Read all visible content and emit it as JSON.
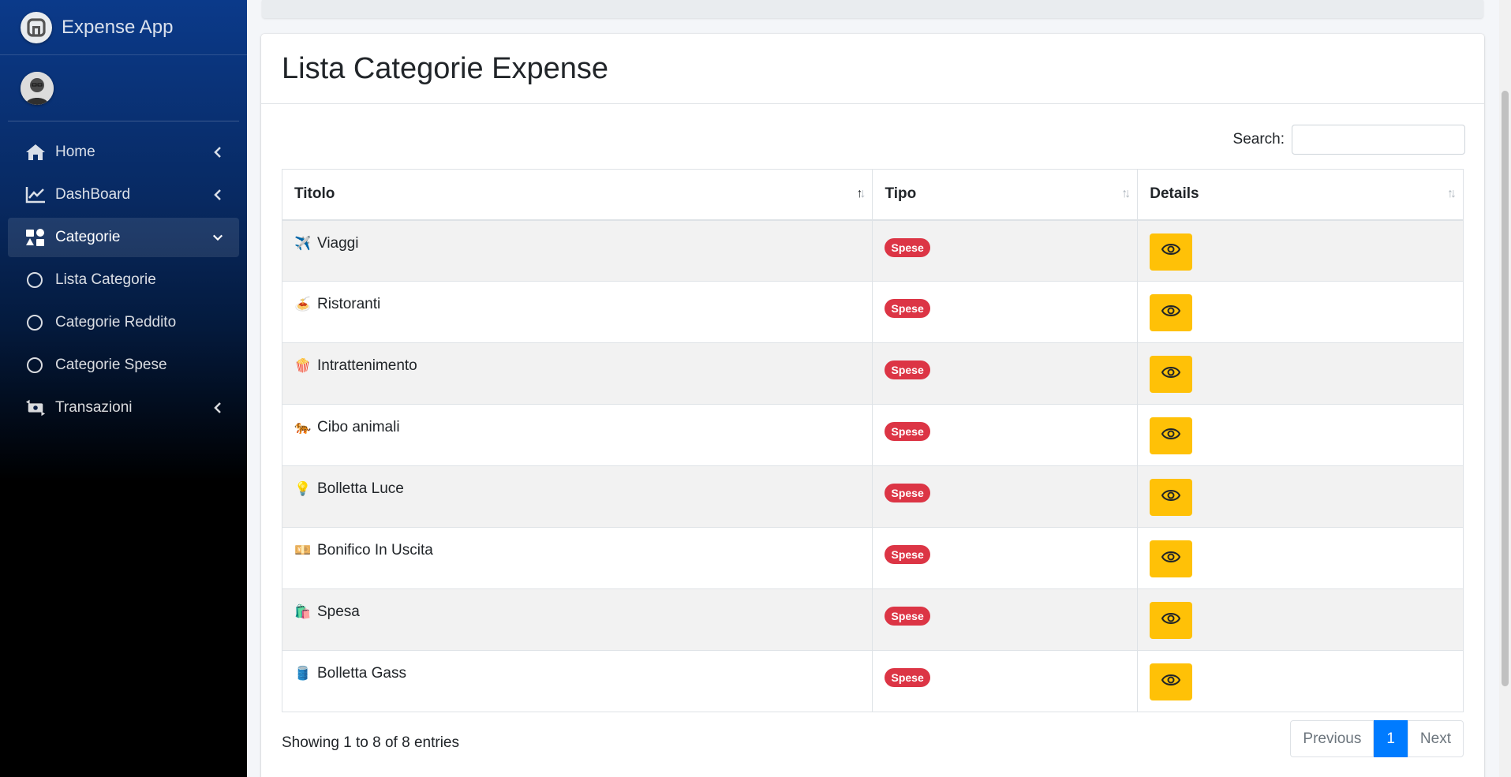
{
  "app": {
    "title": "Expense App"
  },
  "sidebar": {
    "items": [
      {
        "label": "Home",
        "icon": "home-icon"
      },
      {
        "label": "DashBoard",
        "icon": "chart-line-icon"
      },
      {
        "label": "Categorie",
        "icon": "categories-icon"
      },
      {
        "label": "Lista Categorie"
      },
      {
        "label": "Categorie Reddito"
      },
      {
        "label": "Categorie Spese"
      },
      {
        "label": "Transazioni",
        "icon": "money-transfer-icon"
      }
    ]
  },
  "main": {
    "title": "Lista Categorie Expense",
    "search": {
      "label": "Search:",
      "value": ""
    },
    "table": {
      "headers": [
        "Titolo",
        "Tipo",
        "Details"
      ],
      "rows": [
        {
          "icon": "✈️",
          "title": "Viaggi",
          "type": "Spese"
        },
        {
          "icon": "🍝",
          "title": "Ristoranti",
          "type": "Spese"
        },
        {
          "icon": "🍿",
          "title": "Intrattenimento",
          "type": "Spese"
        },
        {
          "icon": "🐅",
          "title": "Cibo animali",
          "type": "Spese"
        },
        {
          "icon": "💡",
          "title": "Bolletta Luce",
          "type": "Spese"
        },
        {
          "icon": "💴",
          "title": "Bonifico In Uscita",
          "type": "Spese"
        },
        {
          "icon": "🛍️",
          "title": "Spesa",
          "type": "Spese"
        },
        {
          "icon": "🛢️",
          "title": "Bolletta Gass",
          "type": "Spese"
        }
      ]
    },
    "info": "Showing 1 to 8 of 8 entries",
    "pagination": {
      "previous": "Previous",
      "current": "1",
      "next": "Next"
    }
  },
  "colors": {
    "accent": "#007bff",
    "badge": "#dc3545",
    "details_button": "#ffc107"
  }
}
